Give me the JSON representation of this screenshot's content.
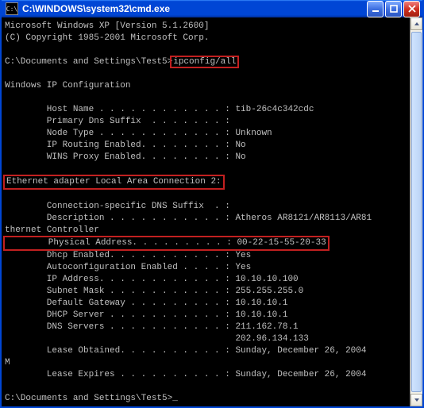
{
  "window": {
    "title": "C:\\WINDOWS\\system32\\cmd.exe",
    "icon_label": "C:\\"
  },
  "header": {
    "line1": "Microsoft Windows XP [Version 5.1.2600]",
    "line2": "(C) Copyright 1985-2001 Microsoft Corp."
  },
  "prompt_path": "C:\\Documents and Settings\\Test5>",
  "command": "ipconfig/all",
  "sections": {
    "win_ip_cfg_title": "Windows IP Configuration",
    "host_name": "        Host Name . . . . . . . . . . . . : tib-26c4c342cdc",
    "primary_dns": "        Primary Dns Suffix  . . . . . . . :",
    "node_type": "        Node Type . . . . . . . . . . . . : Unknown",
    "ip_routing": "        IP Routing Enabled. . . . . . . . : No",
    "wins_proxy": "        WINS Proxy Enabled. . . . . . . . : No",
    "adapter_title": "Ethernet adapter Local Area Connection 2:",
    "conn_dns": "        Connection-specific DNS Suffix  . :",
    "description": "        Description . . . . . . . . . . . : Atheros AR8121/AR8113/AR81",
    "description_wrap": "thernet Controller",
    "phys_line": "        Physical Address. . . . . . . . . : 00-22-15-55-20-33",
    "dhcp_enabled": "        Dhcp Enabled. . . . . . . . . . . : Yes",
    "autoconf": "        Autoconfiguration Enabled . . . . : Yes",
    "ip_addr": "        IP Address. . . . . . . . . . . . : 10.10.10.100",
    "subnet": "        Subnet Mask . . . . . . . . . . . : 255.255.255.0",
    "gateway": "        Default Gateway . . . . . . . . . : 10.10.10.1",
    "dhcp_server": "        DHCP Server . . . . . . . . . . . : 10.10.10.1",
    "dns_servers": "        DNS Servers . . . . . . . . . . . : 211.162.78.1",
    "dns_servers2": "                                            202.96.134.133",
    "lease_obt": "        Lease Obtained. . . . . . . . . . : Sunday, December 26, 2004",
    "lease_obt_wrap": "M",
    "lease_exp": "        Lease Expires . . . . . . . . . . : Sunday, December 26, 2004"
  },
  "prompt2": "C:\\Documents and Settings\\Test5>",
  "cursor": "_",
  "highlights": {
    "color": "#c22020"
  }
}
